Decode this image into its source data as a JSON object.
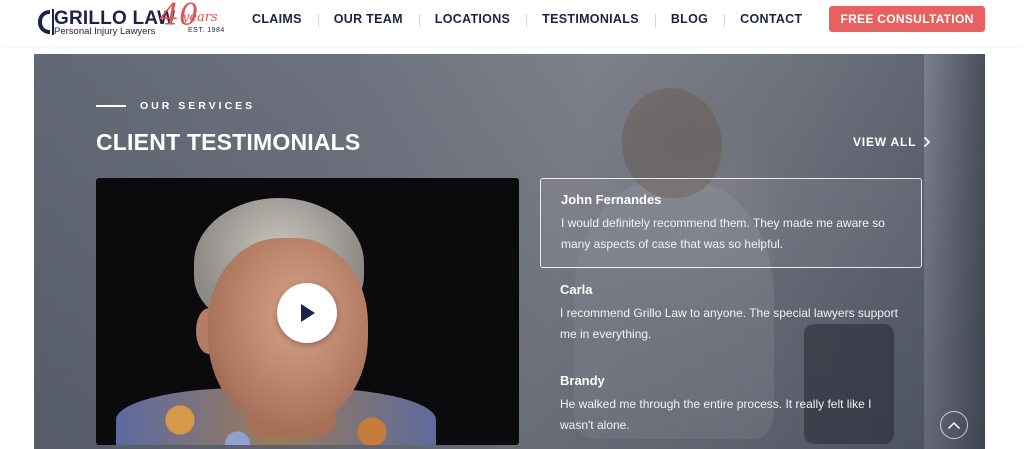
{
  "header": {
    "logo": {
      "name": "GRILLO LAW",
      "tagline": "Personal Injury Lawyers",
      "forty": "40",
      "years": "years",
      "est": "EST. 1984"
    },
    "nav": [
      "CLAIMS",
      "OUR TEAM",
      "LOCATIONS",
      "TESTIMONIALS",
      "BLOG",
      "CONTACT"
    ],
    "cta_label": "FREE CONSULTATION",
    "colors": {
      "navy": "#1d2247",
      "accent": "#e8605f"
    }
  },
  "section": {
    "eyebrow": "OUR SERVICES",
    "title": "CLIENT TESTIMONIALS",
    "view_all": "VIEW ALL"
  },
  "video": {
    "play_icon": "play-icon"
  },
  "testimonials": [
    {
      "name": "John Fernandes",
      "text": "I would definitely recommend them. They made me aware so many aspects of case that was so helpful.",
      "active": true
    },
    {
      "name": "Carla",
      "text": "I recommend Grillo Law to anyone. The special lawyers support me in everything.",
      "active": false
    },
    {
      "name": "Brandy",
      "text": "He walked me through the entire process. It really felt like I wasn't alone.",
      "active": false
    }
  ]
}
